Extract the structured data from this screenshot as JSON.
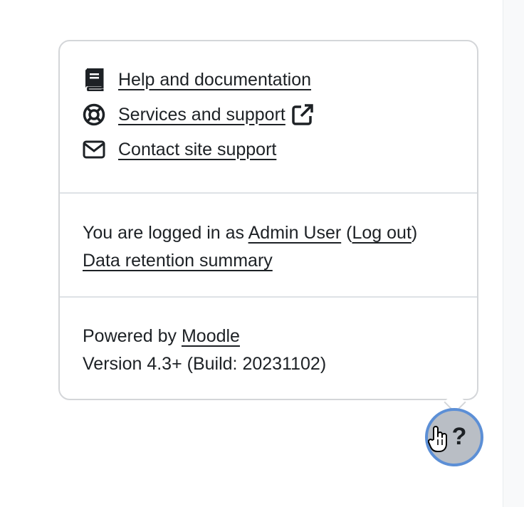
{
  "help_menu": {
    "items": [
      {
        "label": "Help and documentation",
        "icon": "book-icon"
      },
      {
        "label": "Services and support",
        "icon": "life-ring-icon",
        "external_icon": "external-link-icon"
      },
      {
        "label": "Contact site support",
        "icon": "envelope-icon"
      }
    ]
  },
  "login_info": {
    "prefix": "You are logged in as ",
    "user": "Admin User",
    "open_paren": " (",
    "logout": "Log out",
    "close_paren": ")",
    "data_retention": "Data retention summary"
  },
  "footer": {
    "powered_prefix": "Powered by ",
    "moodle_link": "Moodle",
    "version": "Version 4.3+ (Build: 20231102)"
  },
  "help_button": {
    "label": "?"
  }
}
